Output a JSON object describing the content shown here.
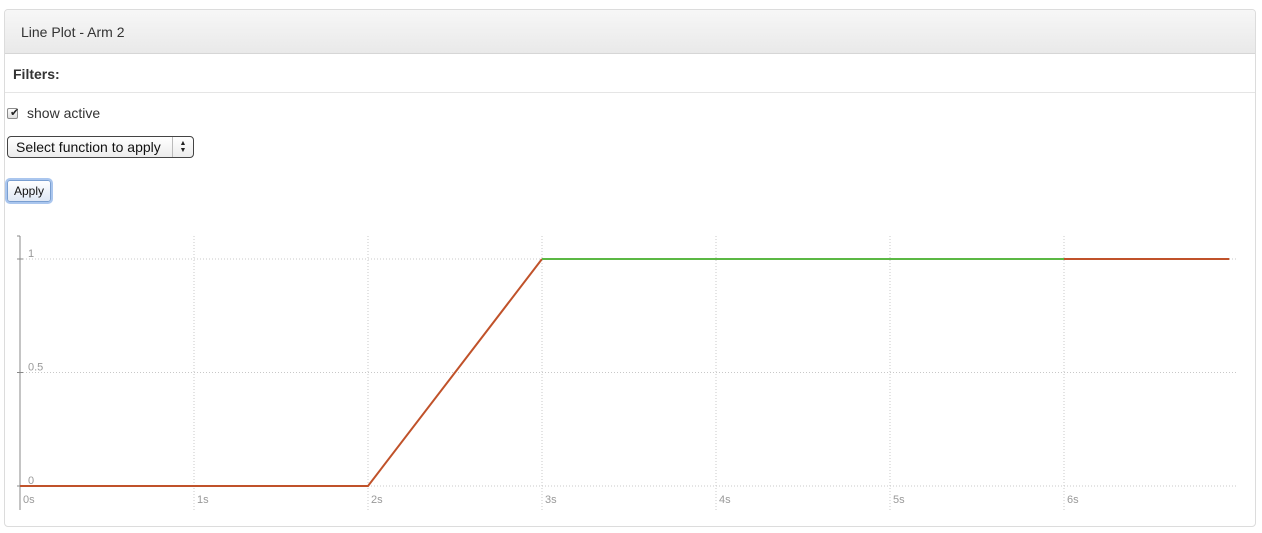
{
  "panel": {
    "title": "Line Plot - Arm 2"
  },
  "filters": {
    "label": "Filters:"
  },
  "controls": {
    "show_active_label": "show active",
    "show_active_checked": true,
    "select_value": "Select function to apply",
    "apply_label": "Apply"
  },
  "chart_data": {
    "type": "line",
    "title": "",
    "xlabel": "",
    "ylabel": "",
    "xlim": [
      0,
      6.95
    ],
    "ylim": [
      0,
      1.06
    ],
    "grid": true,
    "x_ticks": [
      "0s",
      "1s",
      "2s",
      "3s",
      "4s",
      "5s",
      "6s"
    ],
    "y_ticks": [
      "0",
      "0.5",
      "1"
    ],
    "series": [
      {
        "color": "#c0522a",
        "x": [
          0,
          2,
          3
        ],
        "y": [
          0,
          0,
          1
        ]
      },
      {
        "color": "#5bb844",
        "x": [
          3,
          6
        ],
        "y": [
          1,
          1
        ]
      },
      {
        "color": "#c0522a",
        "x": [
          6,
          6.95
        ],
        "y": [
          1,
          1
        ]
      }
    ]
  }
}
